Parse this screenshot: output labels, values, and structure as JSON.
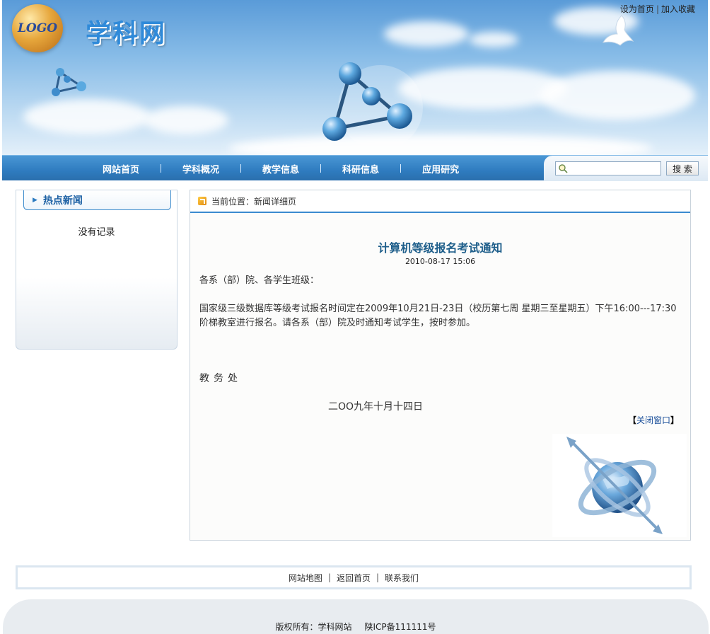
{
  "header": {
    "logo_text": "LOGO",
    "site_title": "学科网",
    "top_links": [
      "设为首页",
      "加入收藏"
    ]
  },
  "nav": {
    "items": [
      "网站首页",
      "学科概况",
      "教学信息",
      "科研信息",
      "应用研究"
    ],
    "search_placeholder": "",
    "search_button": "搜 索"
  },
  "sidebar": {
    "title": "热点新闻",
    "empty_text": "没有记录"
  },
  "main": {
    "breadcrumb": "当前位置：新闻详细页",
    "title": "计算机等级报名考试通知",
    "date": "2010-08-17 15:06",
    "greeting": "各系（部）院、各学生班级：",
    "body": "国家级三级数据库等级考试报名时间定在2009年10月21日-23日（校历第七周 星期三至星期五）下午16:00---17:30阶梯教室进行报名。请各系（部）院及时通知考试学生，按时参加。",
    "signature": "教务处",
    "sign_date": "二OO九年十月十四日",
    "close_link": "关闭窗口",
    "close_brackets": [
      "【",
      "】"
    ]
  },
  "footer": {
    "links": [
      "网站地图",
      "返回首页",
      "联系我们"
    ],
    "copyright": "版权所有：学科网站",
    "icp": "陕ICP备111111号"
  },
  "colors": {
    "nav_blue": "#2f7cc0",
    "title_blue": "#1f5f8b",
    "accent_orange": "#e08a12"
  }
}
